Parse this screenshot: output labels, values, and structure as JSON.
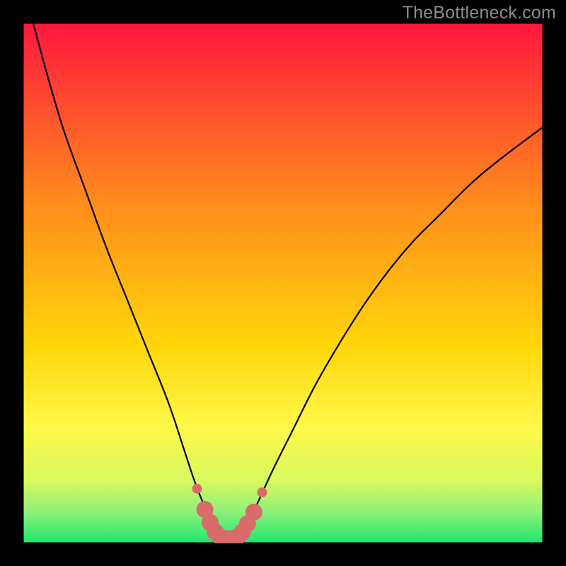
{
  "watermark": "TheBottleneck.com",
  "chart_data": {
    "type": "line",
    "title": "",
    "xlabel": "",
    "ylabel": "",
    "xlim": [
      0,
      100
    ],
    "ylim": [
      0,
      100
    ],
    "grid": false,
    "legend": false,
    "background_gradient": {
      "stops": [
        {
          "offset": 0.0,
          "color": "#ff173e"
        },
        {
          "offset": 0.35,
          "color": "#ff8d1b"
        },
        {
          "offset": 0.62,
          "color": "#ffd60a"
        },
        {
          "offset": 0.78,
          "color": "#fff94a"
        },
        {
          "offset": 0.88,
          "color": "#d8f85e"
        },
        {
          "offset": 0.94,
          "color": "#8ef07a"
        },
        {
          "offset": 1.0,
          "color": "#1ee66e"
        }
      ]
    },
    "series": [
      {
        "name": "bottleneck-curve",
        "color": "#000000",
        "x": [
          2,
          5,
          8,
          12,
          16,
          20,
          24,
          28,
          31,
          33,
          35,
          37,
          38.5,
          40,
          41.5,
          43,
          45,
          48,
          52,
          56,
          60,
          65,
          70,
          75,
          80,
          86,
          92,
          100
        ],
        "y": [
          100,
          89,
          79,
          68,
          57,
          47,
          37,
          27,
          18,
          12,
          7,
          3.5,
          1.5,
          0.8,
          1.5,
          3.5,
          7.5,
          14,
          22,
          30,
          37,
          45,
          52,
          58,
          63,
          69,
          74,
          80
        ]
      },
      {
        "name": "highlight-arc",
        "color": "#d96b6b",
        "type": "scatter",
        "x": [
          33.5,
          35,
          36,
          37,
          38,
          39.2,
          40.2,
          41.2,
          42.2,
          43.2,
          44.4,
          46.0
        ],
        "y": [
          10.5,
          6.5,
          4.0,
          2.2,
          1.2,
          0.9,
          0.9,
          1.2,
          2.2,
          3.8,
          6.0,
          9.8
        ]
      }
    ]
  }
}
